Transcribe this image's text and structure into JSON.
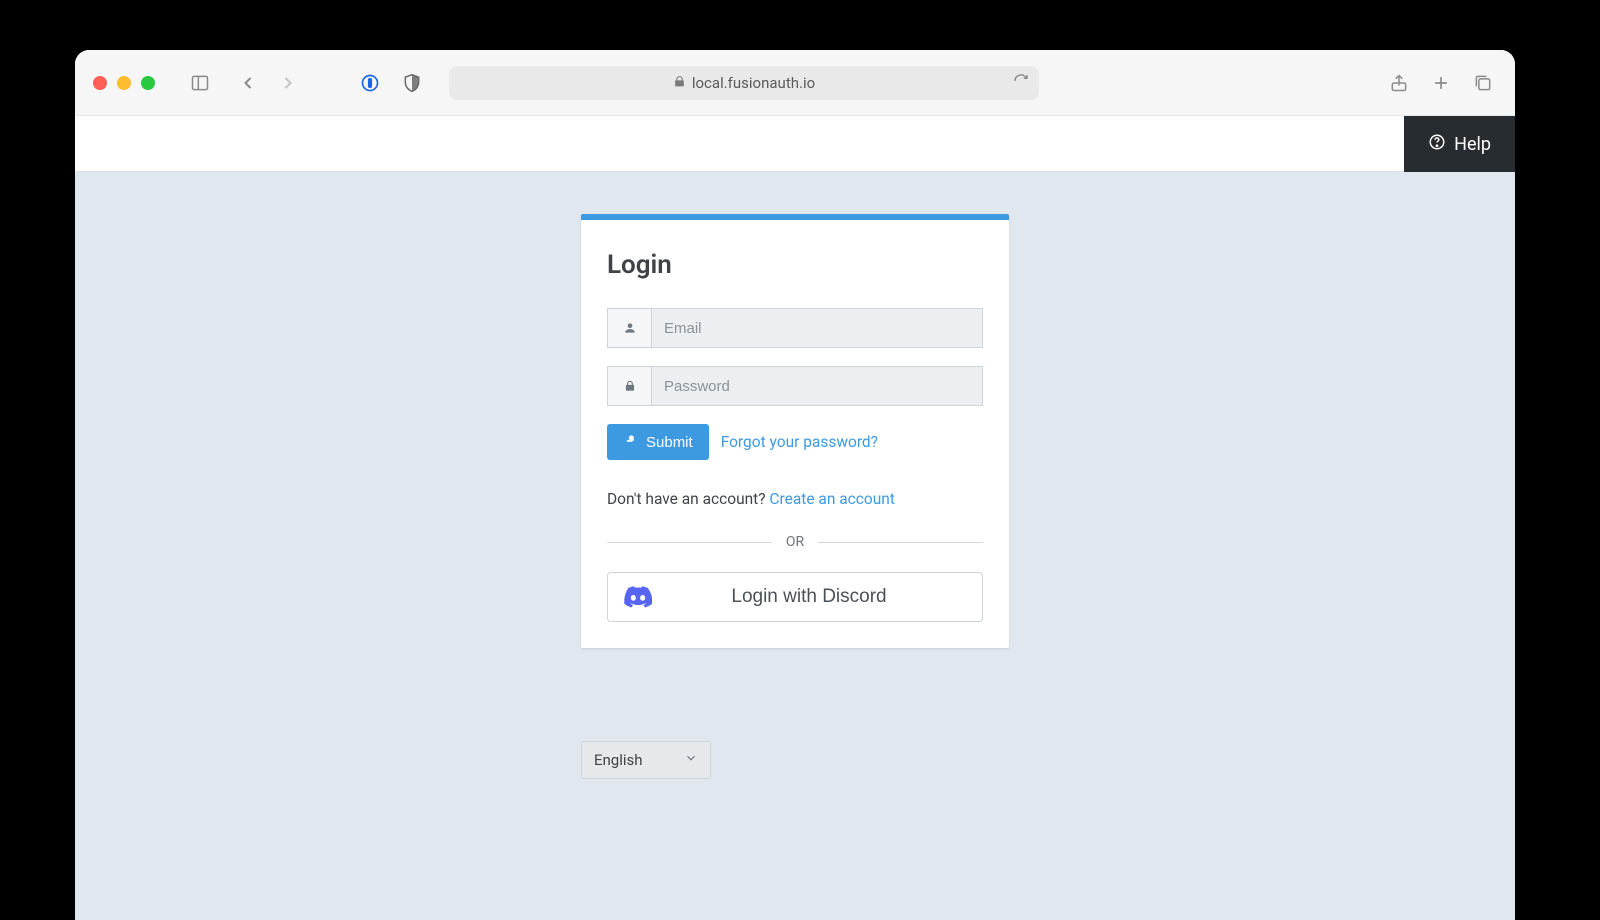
{
  "browser": {
    "url": "local.fusionauth.io"
  },
  "topbar": {
    "help_label": "Help"
  },
  "card": {
    "title": "Login",
    "email_placeholder": "Email",
    "password_placeholder": "Password",
    "submit_label": "Submit",
    "forgot_label": "Forgot your password?",
    "signup_prompt": "Don't have an account? ",
    "signup_link": "Create an account",
    "divider_label": "OR",
    "discord_label": "Login with Discord"
  },
  "language": {
    "selected": "English"
  }
}
